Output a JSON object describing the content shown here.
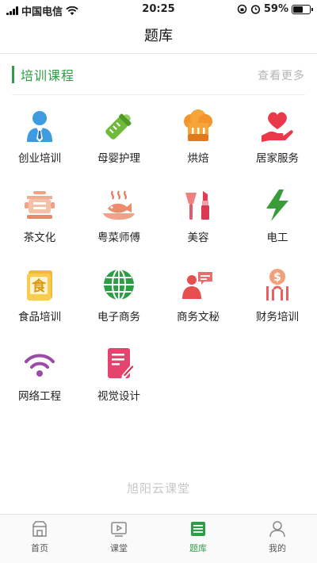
{
  "status": {
    "carrier": "中国电信",
    "time": "20:25",
    "battery_percent": "59%",
    "battery_level": 0.59
  },
  "nav": {
    "title": "题库"
  },
  "section": {
    "title": "培训课程",
    "more": "查看更多"
  },
  "courses": [
    {
      "label": "创业培训",
      "icon": "person-tie-icon"
    },
    {
      "label": "母婴护理",
      "icon": "baby-bottle-icon"
    },
    {
      "label": "烘焙",
      "icon": "chef-hat-icon"
    },
    {
      "label": "居家服务",
      "icon": "hand-heart-icon"
    },
    {
      "label": "茶文化",
      "icon": "tea-pot-icon"
    },
    {
      "label": "粤菜师傅",
      "icon": "fish-dish-icon"
    },
    {
      "label": "美容",
      "icon": "cosmetics-icon"
    },
    {
      "label": "电工",
      "icon": "lightning-icon"
    },
    {
      "label": "食品培训",
      "icon": "food-book-icon"
    },
    {
      "label": "电子商务",
      "icon": "globe-icon"
    },
    {
      "label": "商务文秘",
      "icon": "presenter-icon"
    },
    {
      "label": "财务培训",
      "icon": "dollar-coin-icon"
    },
    {
      "label": "网络工程",
      "icon": "wifi-icon"
    },
    {
      "label": "视觉设计",
      "icon": "design-doc-icon"
    }
  ],
  "brand": "旭阳云课堂",
  "tabs": [
    {
      "label": "首页",
      "icon": "home-icon",
      "active": false
    },
    {
      "label": "课堂",
      "icon": "classroom-icon",
      "active": false
    },
    {
      "label": "题库",
      "icon": "question-bank-icon",
      "active": true
    },
    {
      "label": "我的",
      "icon": "profile-icon",
      "active": false
    }
  ],
  "colors": {
    "accent": "#2e9e46",
    "muted": "#b5b5b5"
  }
}
